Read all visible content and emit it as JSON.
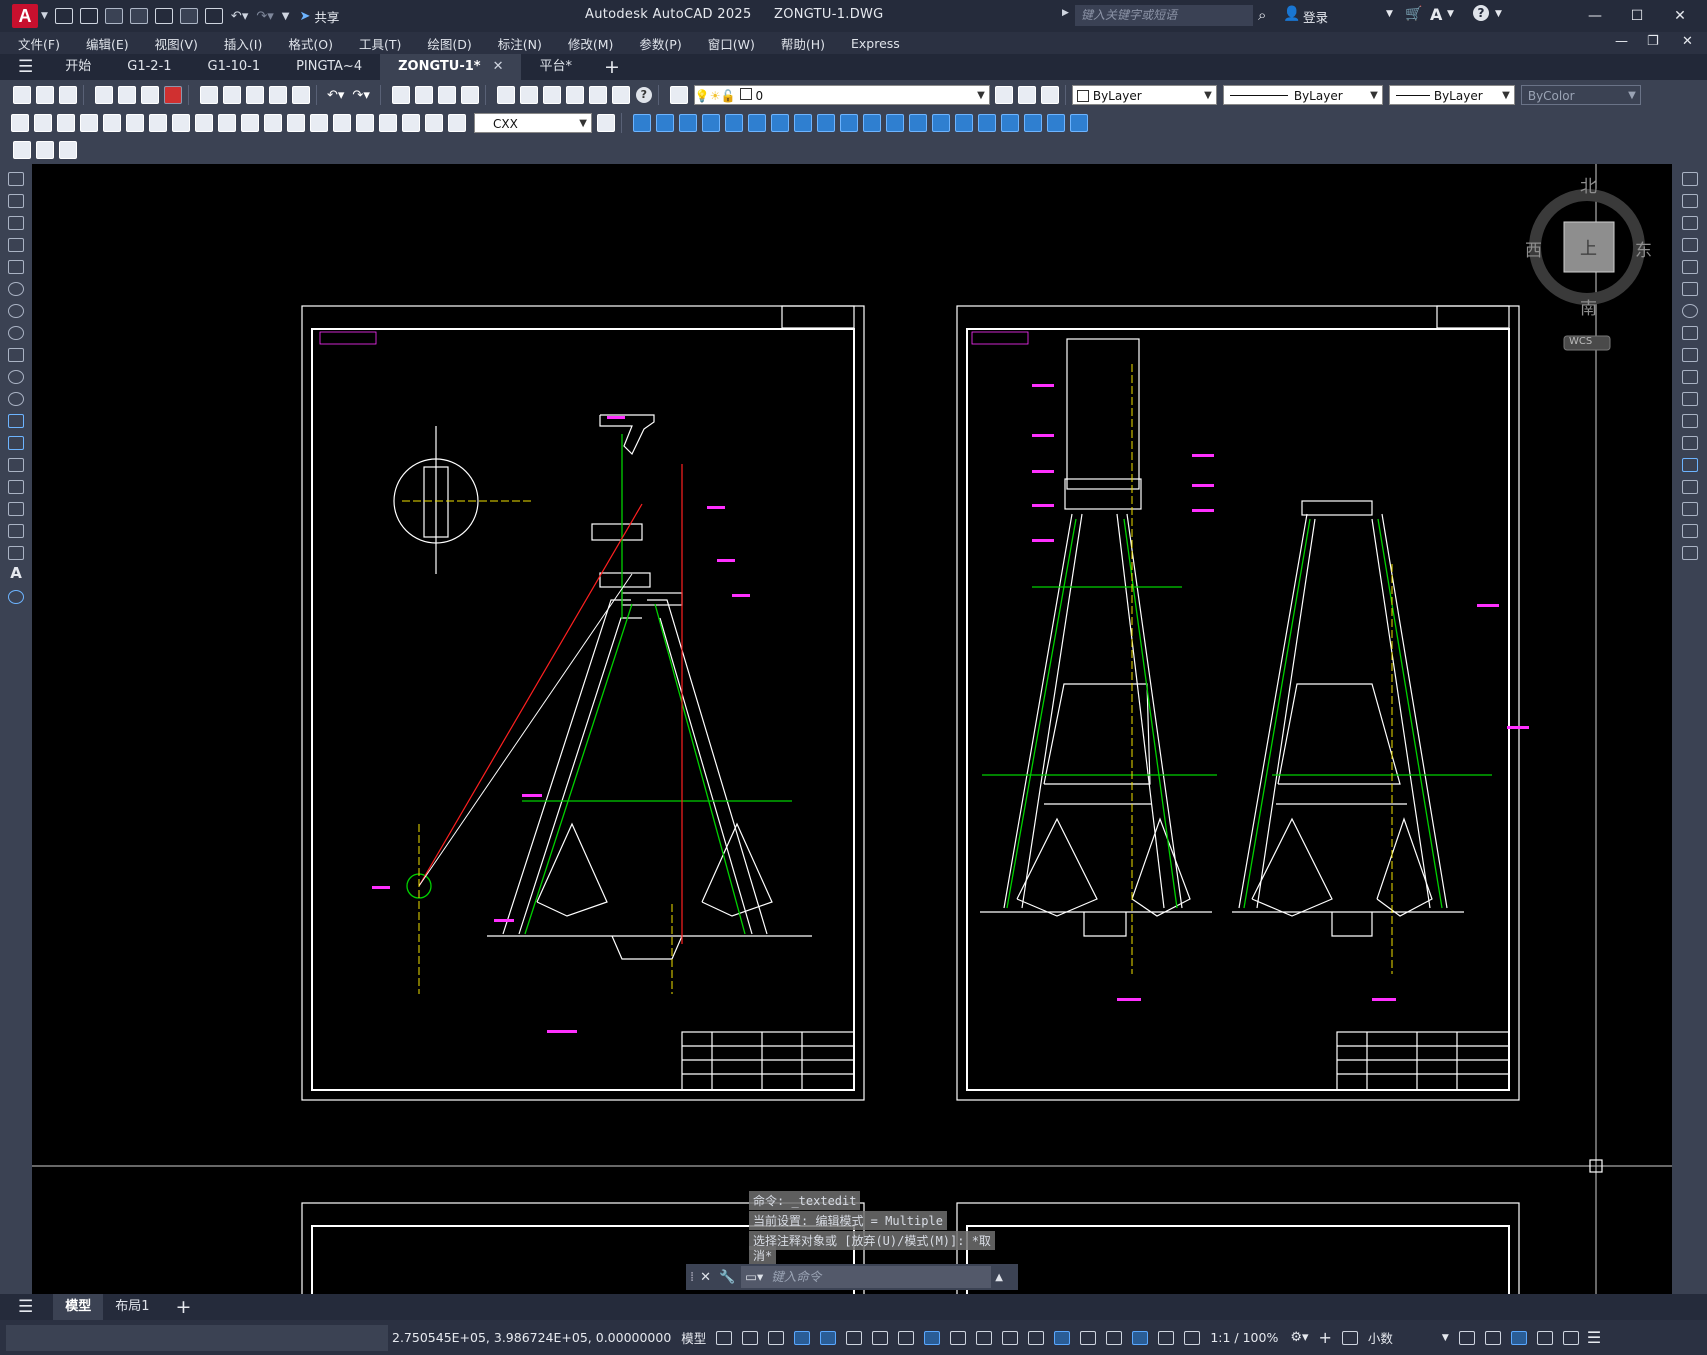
{
  "app": {
    "title": "Autodesk AutoCAD 2025",
    "filename": "ZONGTU-1.DWG",
    "logo_letter": "A",
    "share_label": "共享",
    "search_placeholder": "键入关键字或短语",
    "login_label": "登录"
  },
  "menu": [
    "文件(F)",
    "编辑(E)",
    "视图(V)",
    "插入(I)",
    "格式(O)",
    "工具(T)",
    "绘图(D)",
    "标注(N)",
    "修改(M)",
    "参数(P)",
    "窗口(W)",
    "帮助(H)",
    "Express"
  ],
  "tabs": [
    {
      "label": "开始",
      "active": false
    },
    {
      "label": "G1-2-1",
      "active": false
    },
    {
      "label": "G1-10-1",
      "active": false
    },
    {
      "label": "PINGTA~4",
      "active": false
    },
    {
      "label": "ZONGTU-1*",
      "active": true
    },
    {
      "label": "平台*",
      "active": false
    }
  ],
  "toolbar": {
    "layer_value": "0",
    "color_value": "ByLayer",
    "linetype_value": "ByLayer",
    "lineweight_value": "ByLayer",
    "plotstyle_value": "ByColor",
    "dimstyle_value": "CXX"
  },
  "viewcube": {
    "north": "北",
    "south": "南",
    "east": "东",
    "west": "西",
    "face": "上",
    "wcs": "WCS"
  },
  "command_history": [
    "命令: _textedit",
    "当前设置: 编辑模式 = Multiple",
    "选择注释对象或 [放弃(U)/模式(M)]: *取",
    "消*"
  ],
  "command_placeholder": "键入命令",
  "layout_tabs": [
    {
      "label": "模型",
      "active": true
    },
    {
      "label": "布局1",
      "active": false
    }
  ],
  "status": {
    "coordinates": "2.750545E+05, 3.986724E+05, 0.00000000",
    "space": "模型",
    "scale": "1:1 / 100%",
    "units": "小数"
  },
  "colors": {
    "accent": "#2f7fd0",
    "canvas": "#000000",
    "ui": "#3b4253",
    "red": "#ff2020",
    "green": "#00d000",
    "magenta": "#ff30ff",
    "yellow": "#f0e000"
  }
}
